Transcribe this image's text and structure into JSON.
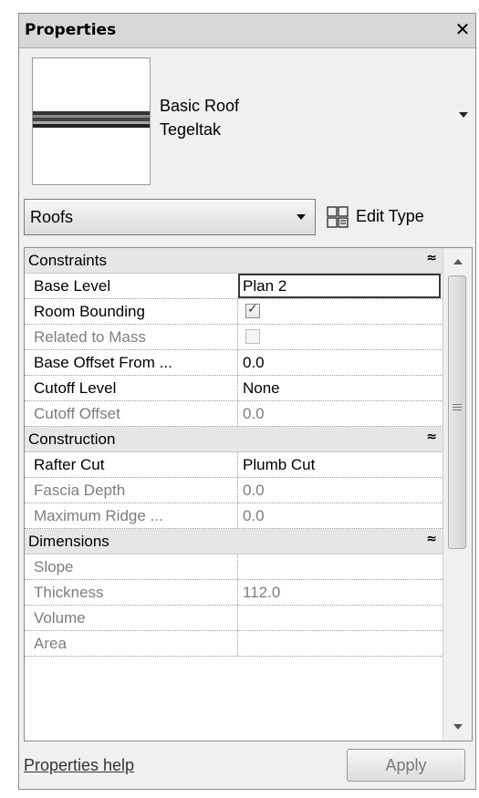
{
  "window": {
    "title": "Properties",
    "close_glyph": "✕"
  },
  "type_selector": {
    "family": "Basic Roof",
    "type": "Tegeltak"
  },
  "filter": {
    "category": "Roofs",
    "edit_type_label": "Edit Type"
  },
  "sections": {
    "constraints": {
      "label": "Constraints"
    },
    "construction": {
      "label": "Construction"
    },
    "dimensions": {
      "label": "Dimensions"
    }
  },
  "rows": {
    "base_level": {
      "name": "Base Level",
      "value": "Plan 2"
    },
    "room_bounding": {
      "name": "Room Bounding",
      "checked": true
    },
    "related_to_mass": {
      "name": "Related to Mass",
      "checked": false
    },
    "base_offset": {
      "name": "Base Offset From ...",
      "value": "0.0"
    },
    "cutoff_level": {
      "name": "Cutoff Level",
      "value": "None"
    },
    "cutoff_offset": {
      "name": "Cutoff Offset",
      "value": "0.0"
    },
    "rafter_cut": {
      "name": "Rafter Cut",
      "value": "Plumb Cut"
    },
    "fascia_depth": {
      "name": "Fascia Depth",
      "value": "0.0"
    },
    "maximum_ridge": {
      "name": "Maximum Ridge ...",
      "value": "0.0"
    },
    "slope": {
      "name": "Slope",
      "value": ""
    },
    "thickness": {
      "name": "Thickness",
      "value": "112.0"
    },
    "volume": {
      "name": "Volume",
      "value": ""
    },
    "area": {
      "name": "Area",
      "value": ""
    }
  },
  "glyphs": {
    "collapse": "≈",
    "check": "✓"
  },
  "footer": {
    "help_link": "Properties help",
    "apply_label": "Apply"
  }
}
